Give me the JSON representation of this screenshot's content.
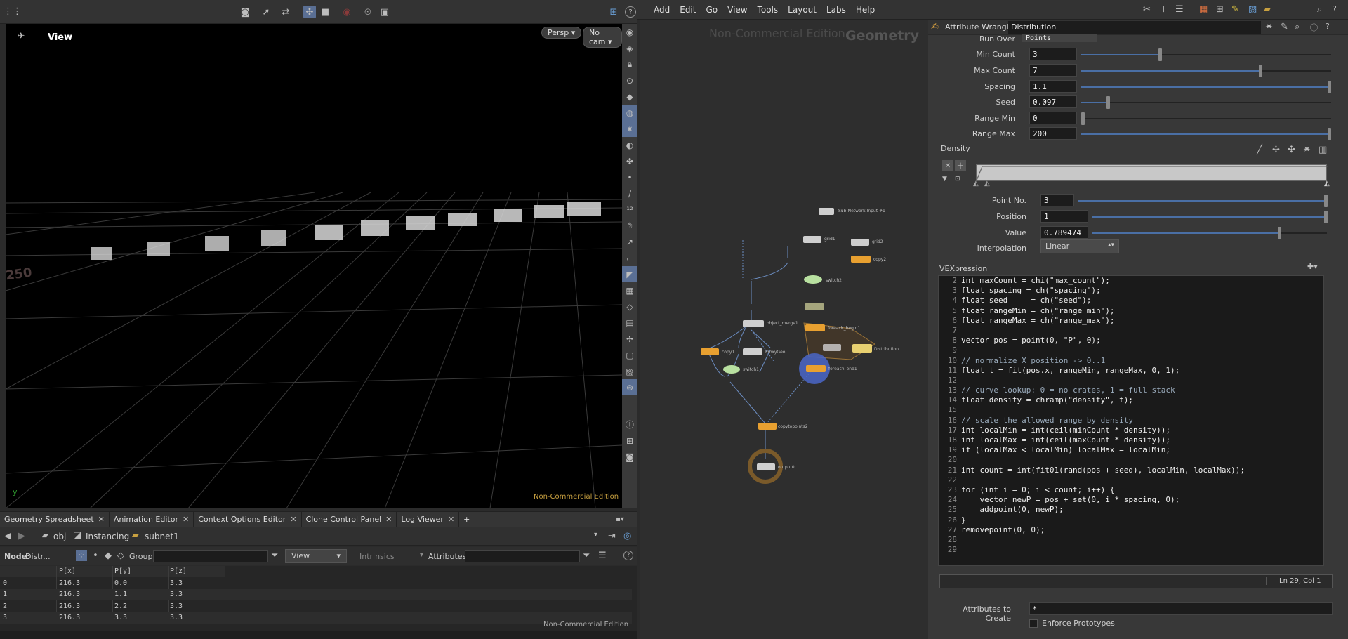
{
  "toolbar": {
    "left_icons": [
      "grid-menu-icon"
    ],
    "view_icons": [
      "camera-icon",
      "select-icon",
      "transform-icon",
      "snap-icon",
      "box-icon",
      "record-icon",
      "timer-icon",
      "display-icon"
    ]
  },
  "viewport": {
    "title": "View",
    "persp": "Persp ▾",
    "cam": "No cam ▾",
    "watermark": "Non-Commercial Edition",
    "axis": "y",
    "ground_label": "250"
  },
  "bottom_tabs": [
    {
      "label": "Geometry Spreadsheet"
    },
    {
      "label": "Animation Editor"
    },
    {
      "label": "Context Options Editor"
    },
    {
      "label": "Clone Control Panel"
    },
    {
      "label": "Log Viewer"
    }
  ],
  "path": {
    "root": "obj",
    "p1": "Instancing",
    "p2": "subnet1"
  },
  "sheet": {
    "node_label": "Node:",
    "node_value": "Distr...",
    "group_label": "Group:",
    "view_label": "View",
    "intrinsics_label": "Intrinsics",
    "attributes_label": "Attributes:",
    "watermark": "Non-Commercial Edition",
    "columns": [
      "",
      "P[x]",
      "P[y]",
      "P[z]"
    ],
    "rows": [
      [
        "0",
        "216.3",
        "0.0",
        "3.3"
      ],
      [
        "1",
        "216.3",
        "1.1",
        "3.3"
      ],
      [
        "2",
        "216.3",
        "2.2",
        "3.3"
      ],
      [
        "3",
        "216.3",
        "3.3",
        "3.3"
      ]
    ]
  },
  "menu": [
    "Add",
    "Edit",
    "Go",
    "View",
    "Tools",
    "Layout",
    "Labs",
    "Help"
  ],
  "network": {
    "watermark": "Non-Commercial Edition",
    "context": "Geometry",
    "nodes": {
      "subnet_input": "Sub-Network Input #1",
      "grid1": "grid1",
      "grid2": "grid2",
      "copy2": "copy2",
      "switch2": "switch2",
      "object_merge1": "object_merge1",
      "copy1": "copy1",
      "proxygeo": "ProxyGeo",
      "switch1": "switch1",
      "foreach_begin": "foreach_begin1",
      "distribution": "Distribution",
      "foreach_end": "foreach_end1",
      "copytopoints": "copytopoints2",
      "output": "output0"
    }
  },
  "params": {
    "node_type": "Attribute Wrangle",
    "node_name": "Distribution",
    "run_over_label": "Run Over",
    "run_over_value": "Points",
    "fields": [
      {
        "label": "Min Count",
        "value": "3",
        "pos": 0.31
      },
      {
        "label": "Max Count",
        "value": "7",
        "pos": 0.71
      },
      {
        "label": "Spacing",
        "value": "1.1",
        "pos": 1.0
      },
      {
        "label": "Seed",
        "value": "0.097",
        "pos": 0.1
      },
      {
        "label": "Range Min",
        "value": "0",
        "pos": 0.0
      },
      {
        "label": "Range Max",
        "value": "200",
        "pos": 1.0
      }
    ],
    "density_label": "Density",
    "point_no_label": "Point No.",
    "point_no": "3",
    "position_label": "Position",
    "position": "1",
    "value_label": "Value",
    "value": "0.789474",
    "value_pos": 0.79,
    "interp_label": "Interpolation",
    "interp": "Linear",
    "vex_label": "VEXpression",
    "status": "Ln 29, Col 1",
    "attr_create_label": "Attributes to Create",
    "attr_create": "*",
    "enforce_label": "Enforce Prototypes"
  },
  "code": [
    {
      "n": "2",
      "t": "int maxCount = chi(\"max_count\");"
    },
    {
      "n": "3",
      "t": "float spacing = ch(\"spacing\");"
    },
    {
      "n": "4",
      "t": "float seed     = ch(\"seed\");"
    },
    {
      "n": "5",
      "t": "float rangeMin = ch(\"range_min\");"
    },
    {
      "n": "6",
      "t": "float rangeMax = ch(\"range_max\");"
    },
    {
      "n": "7",
      "t": ""
    },
    {
      "n": "8",
      "t": "vector pos = point(0, \"P\", 0);"
    },
    {
      "n": "9",
      "t": ""
    },
    {
      "n": "10",
      "t": "// normalize X position -> 0..1"
    },
    {
      "n": "11",
      "t": "float t = fit(pos.x, rangeMin, rangeMax, 0, 1);"
    },
    {
      "n": "12",
      "t": ""
    },
    {
      "n": "13",
      "t": "// curve lookup: 0 = no crates, 1 = full stack"
    },
    {
      "n": "14",
      "t": "float density = chramp(\"density\", t);"
    },
    {
      "n": "15",
      "t": ""
    },
    {
      "n": "16",
      "t": "// scale the allowed range by density"
    },
    {
      "n": "17",
      "t": "int localMin = int(ceil(minCount * density));"
    },
    {
      "n": "18",
      "t": "int localMax = int(ceil(maxCount * density));"
    },
    {
      "n": "19",
      "t": "if (localMax < localMin) localMax = localMin;"
    },
    {
      "n": "20",
      "t": ""
    },
    {
      "n": "21",
      "t": "int count = int(fit01(rand(pos + seed), localMin, localMax));"
    },
    {
      "n": "22",
      "t": ""
    },
    {
      "n": "23",
      "t": "for (int i = 0; i < count; i++) {"
    },
    {
      "n": "24",
      "t": "    vector newP = pos + set(0, i * spacing, 0);"
    },
    {
      "n": "25",
      "t": "    addpoint(0, newP);"
    },
    {
      "n": "26",
      "t": "}"
    },
    {
      "n": "27",
      "t": "removepoint(0, 0);"
    },
    {
      "n": "28",
      "t": ""
    },
    {
      "n": "29",
      "t": ""
    }
  ]
}
